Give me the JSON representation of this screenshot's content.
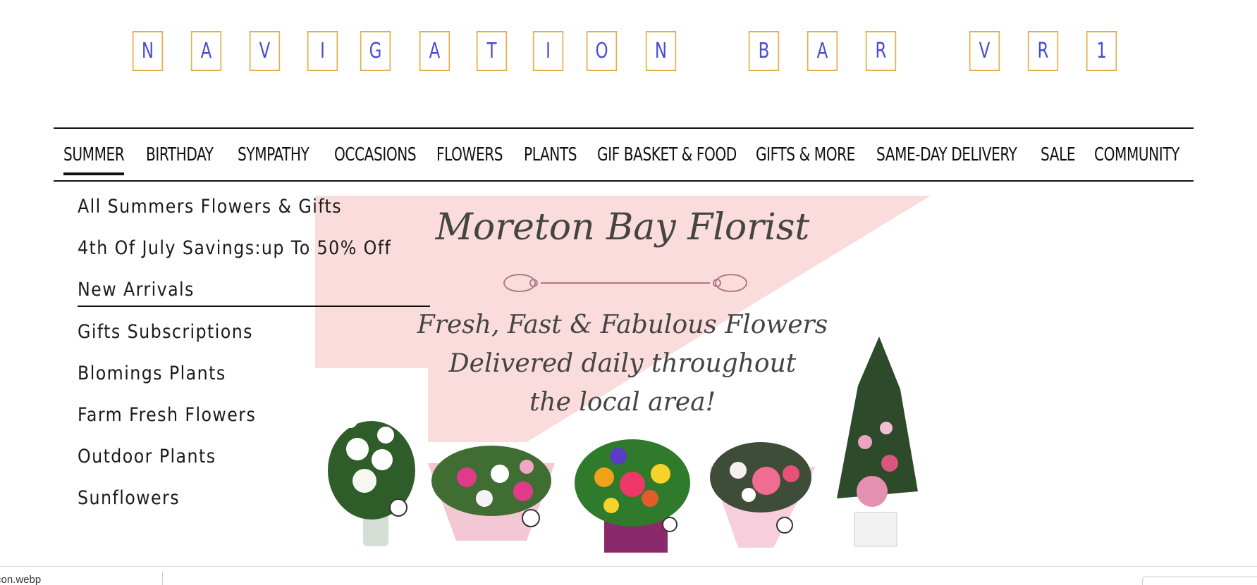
{
  "title": {
    "letters": [
      "N",
      "A",
      "V",
      "I",
      "G",
      "A",
      "T",
      "I",
      "O",
      "N",
      "B",
      "A",
      "R",
      "V",
      "R",
      "1"
    ]
  },
  "nav": {
    "items": [
      "SUMMER",
      "BIRTHDAY",
      "SYMPATHY",
      "OCCASIONS",
      "FLOWERS",
      "PLANTS",
      "GIF BASKET & FOOD",
      "GIFTS & MORE",
      "SAME-DAY DELIVERY",
      "SALE",
      "COMMUNITY"
    ],
    "active": "SUMMER"
  },
  "submenu": {
    "items": [
      "All Summers Flowers & Gifts",
      "4th Of July Savings:up To 50% Off",
      "New Arrivals",
      "Gifts Subscriptions",
      "Blomings Plants",
      "Farm Fresh Flowers",
      "Outdoor Plants",
      "Sunflowers"
    ]
  },
  "banner": {
    "brand": "Moreton Bay Florist",
    "tagline_1": "Fresh, Fast & Fabulous Flowers",
    "tagline_2": "Delivered daily throughout",
    "tagline_3": "the local area!"
  },
  "statusbar": {
    "filename": "con.webp"
  },
  "colors": {
    "title_border": "#e3b04b",
    "title_text": "#4a4ad6",
    "banner_pink": "#fbdcdc"
  }
}
